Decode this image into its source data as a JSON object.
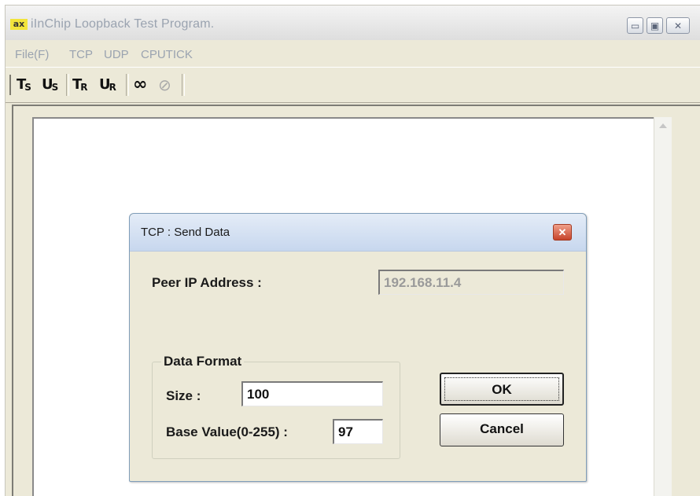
{
  "app": {
    "icon_text": "ax",
    "title": "iInChip Loopback Test Program.",
    "min_glyph": "▭",
    "max_glyph": "▣",
    "close_glyph": "✕"
  },
  "menu": {
    "items": [
      {
        "label": "File(F)"
      },
      {
        "label": "TCP"
      },
      {
        "label": "UDP"
      },
      {
        "label": "CPUTICK"
      }
    ]
  },
  "toolbar": {
    "tcp_send": {
      "main": "T",
      "sub": "S"
    },
    "udp_send": {
      "main": "U",
      "sub": "S"
    },
    "tcp_receive": {
      "main": "T",
      "sub": "R"
    },
    "udp_receive": {
      "main": "U",
      "sub": "R"
    },
    "loop_glyph": "∞",
    "stop_glyph": "⊘"
  },
  "dialog": {
    "title": "TCP : Send Data",
    "close_glyph": "✕",
    "peer_ip_label": "Peer IP Address :",
    "peer_ip_value": "192.168.11.4",
    "group_label": "Data Format",
    "size_label": "Size :",
    "size_value": "100",
    "base_label": "Base Value(0-255) :",
    "base_value": "97",
    "ok_label": "OK",
    "cancel_label": "Cancel"
  }
}
